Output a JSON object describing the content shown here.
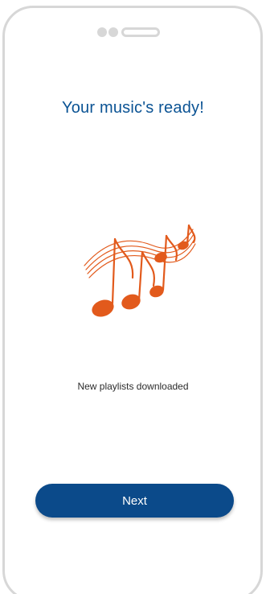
{
  "screen": {
    "headline": "Your music's ready!",
    "status": "New playlists downloaded",
    "next_label": "Next"
  },
  "icons": {
    "illustration": "music-notes-icon"
  },
  "colors": {
    "headline": "#0b5394",
    "button": "#0b4a8a",
    "notes": "#e25a1c",
    "frame": "#d7d7d7"
  }
}
